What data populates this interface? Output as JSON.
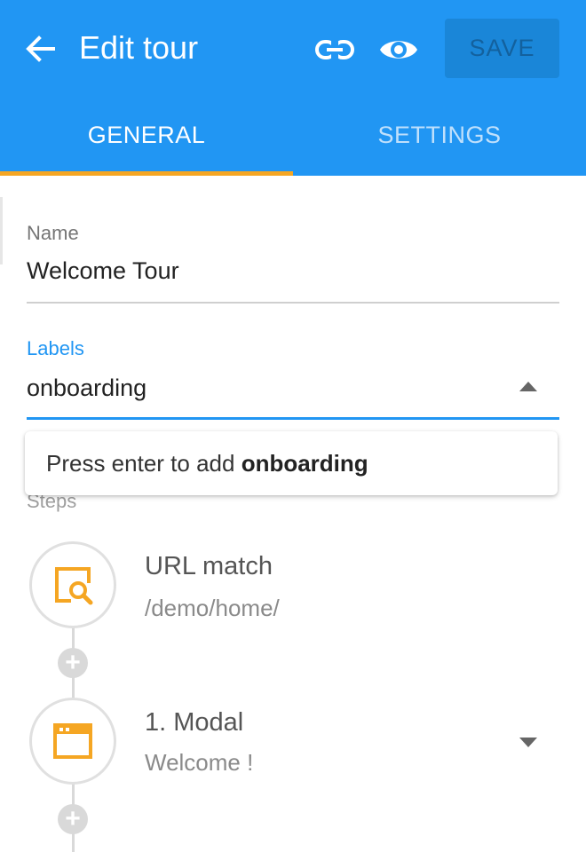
{
  "header": {
    "title": "Edit tour",
    "save_label": "SAVE",
    "icons": {
      "back": "arrow-left-icon",
      "link": "link-icon",
      "preview": "eye-icon"
    },
    "background_color": "#2196f3",
    "tab_indicator_color": "#f5a623"
  },
  "tabs": [
    {
      "label": "GENERAL",
      "active": true
    },
    {
      "label": "SETTINGS",
      "active": false
    }
  ],
  "form": {
    "name": {
      "label": "Name",
      "value": "Welcome Tour"
    },
    "labels": {
      "label": "Labels",
      "value": "onboarding"
    },
    "suggestion": {
      "prefix": "Press enter to add ",
      "term": "onboarding"
    }
  },
  "steps": {
    "label": "Steps",
    "items": [
      {
        "title": "URL match",
        "subtitle": "/demo/home/",
        "icon": "url-search-icon"
      },
      {
        "title": "1. Modal",
        "subtitle": "Welcome !",
        "icon": "modal-window-icon"
      }
    ],
    "accent_color": "#f5a623"
  }
}
